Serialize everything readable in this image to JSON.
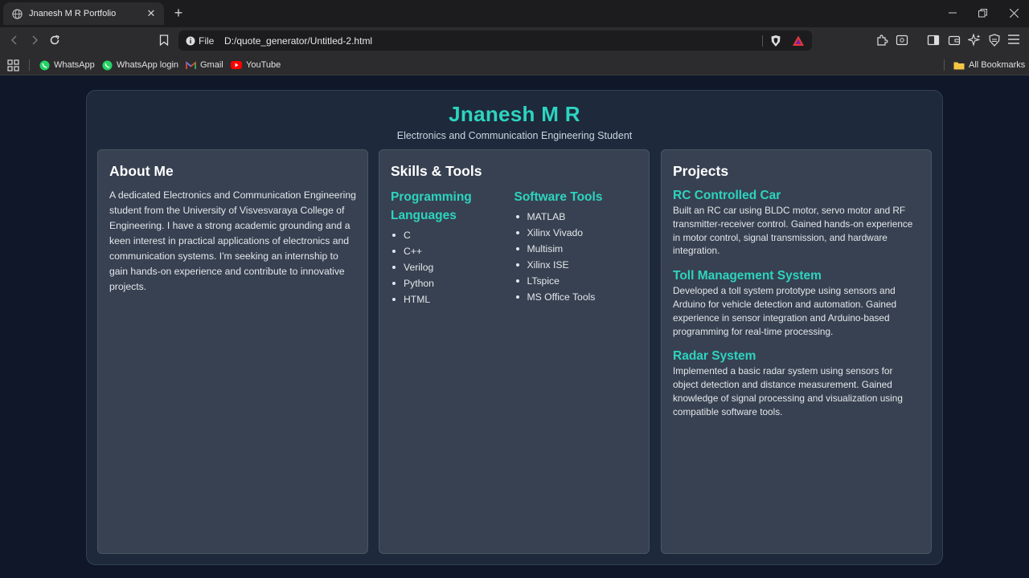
{
  "browser": {
    "tab_title": "Jnanesh M R Portfolio",
    "tab_close": "✕",
    "new_tab": "+",
    "address_scheme": "File",
    "address_url": "D:/quote_generator/Untitled-2.html",
    "bookmarks": [
      {
        "label": "WhatsApp",
        "icon": "whatsapp-icon"
      },
      {
        "label": "WhatsApp login",
        "icon": "whatsapp-icon"
      },
      {
        "label": "Gmail",
        "icon": "gmail-icon"
      },
      {
        "label": "YouTube",
        "icon": "youtube-icon"
      }
    ],
    "all_bookmarks": "All Bookmarks"
  },
  "portfolio": {
    "name": "Jnanesh M R",
    "subtitle": "Electronics and Communication Engineering Student",
    "about": {
      "heading": "About Me",
      "text": "A dedicated Electronics and Communication Engineering student from the University of Visvesvaraya College of Engineering. I have a strong academic grounding and a keen interest in practical applications of electronics and communication systems. I'm seeking an internship to gain hands-on experience and contribute to innovative projects."
    },
    "skills": {
      "heading": "Skills & Tools",
      "programming": {
        "heading": "Programming Languages",
        "items": [
          "C",
          "C++",
          "Verilog",
          "Python",
          "HTML"
        ]
      },
      "software": {
        "heading": "Software Tools",
        "items": [
          "MATLAB",
          "Xilinx Vivado",
          "Multisim",
          "Xilinx ISE",
          "LTspice",
          "MS Office Tools"
        ]
      }
    },
    "projects": {
      "heading": "Projects",
      "items": [
        {
          "title": "RC Controlled Car",
          "desc": "Built an RC car using BLDC motor, servo motor and RF transmitter-receiver control. Gained hands-on experience in motor control, signal transmission, and hardware integration."
        },
        {
          "title": "Toll Management System",
          "desc": "Developed a toll system prototype using sensors and Arduino for vehicle detection and automation. Gained experience in sensor integration and Arduino-based programming for real-time processing."
        },
        {
          "title": "Radar System",
          "desc": "Implemented a basic radar system using sensors for object detection and distance measurement. Gained knowledge of signal processing and visualization using compatible software tools."
        }
      ]
    }
  },
  "colors": {
    "accent": "#2dd4bf",
    "page_bg": "#0f1729",
    "container_bg": "#1e293b",
    "card_bg": "#374151"
  }
}
